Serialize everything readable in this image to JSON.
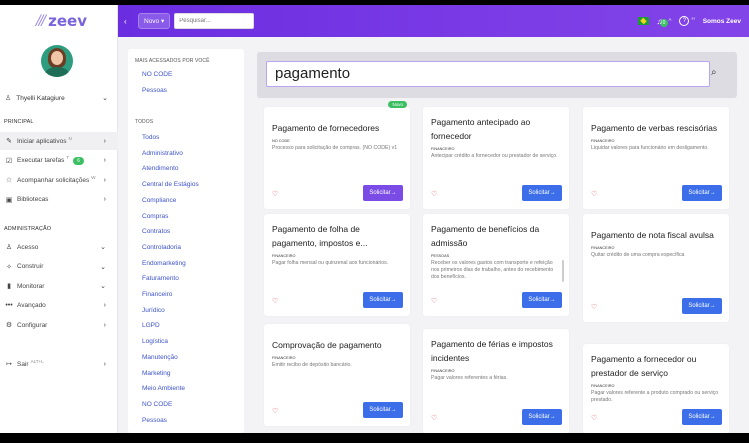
{
  "logo": {
    "text": "zeev"
  },
  "sidebar": {
    "user_name": "Thyelli Katagiure",
    "principal_label": "PRINCIPAL",
    "admin_label": "ADMINISTRAÇÃO",
    "principal_items": [
      {
        "label": "Iniciar aplicativos",
        "sup": "N",
        "icon": "rocket-icon",
        "glyph": "✎"
      },
      {
        "label": "Executar tarefas",
        "sup": "T",
        "badge": "6",
        "icon": "check-square-icon",
        "glyph": "☑"
      },
      {
        "label": "Acompanhar solicitações",
        "sup": "W",
        "icon": "star-icon",
        "glyph": "☆"
      },
      {
        "label": "Bibliotecas",
        "icon": "library-icon",
        "glyph": "▣"
      }
    ],
    "admin_items": [
      {
        "label": "Acesso",
        "icon": "user-icon",
        "glyph": "♙"
      },
      {
        "label": "Construir",
        "icon": "build-icon",
        "glyph": "✧"
      },
      {
        "label": "Monitorar",
        "icon": "bar-chart-icon",
        "glyph": "▮"
      },
      {
        "label": "Avançado",
        "icon": "dots-icon",
        "glyph": "•••"
      },
      {
        "label": "Configurar",
        "icon": "gear-icon",
        "glyph": "⚙"
      }
    ],
    "logout": {
      "label": "Sair",
      "sup": "ALT+L"
    }
  },
  "topbar": {
    "novo_label": "Novo",
    "search_placeholder": "Pesquisar...",
    "notif_count": "0",
    "notif_sup": "A",
    "help_sup": "H",
    "user": "Somos Zeev"
  },
  "filters": {
    "most_accessed_label": "MAIS ACESSADOS POR VOCÊ",
    "most_accessed": [
      "NO CODE",
      "Pessoas"
    ],
    "all_label": "TODOS",
    "all": [
      "Todos",
      "Administrativo",
      "Atendimento",
      "Central de Estágios",
      "Compliance",
      "Compras",
      "Contratos",
      "Controladoria",
      "Endomarketing",
      "Faturamento",
      "Financeiro",
      "Jurídico",
      "LGPD",
      "Logística",
      "Manutenção",
      "Marketing",
      "Meio Ambiente",
      "NO CODE",
      "Pessoas"
    ]
  },
  "search": {
    "value": "pagamento"
  },
  "cards": [
    {
      "title": "Pagamento de fornecedores",
      "category": "NO CODE",
      "desc": "Processo para solicitação de compras. (NO CODE) v1",
      "button": "Solicitar→",
      "badge": "Novo"
    },
    {
      "title": "Pagamento antecipado ao fornecedor",
      "category": "FINANCEIRO",
      "desc": "Antecipar crédito a fornecedor ou prestador de serviço.",
      "button": "Solicitar→"
    },
    {
      "title": "Pagamento de verbas rescisórias",
      "category": "FINANCEIRO",
      "desc": "Liquidar valores para funcionário em desligamento.",
      "button": "Solicitar→"
    },
    {
      "title": "Pagamento de folha de pagamento, impostos e...",
      "category": "FINANCEIRO",
      "desc": "Pagar folha mensal ou quinzenal aos funcionários.",
      "button": "Solicitar→"
    },
    {
      "title": "Pagamento de benefícios da admissão",
      "category": "PESSOAS",
      "desc": "Receber os valores gastos com transporte e refeição nos primeiros dias de trabalho, antes do recebimento dos benefícios.",
      "button": "Solicitar→"
    },
    {
      "title": "Pagamento de nota fiscal avulsa",
      "category": "FINANCEIRO",
      "desc": "Quitar crédito de uma compra específica",
      "button": "Solicitar→"
    },
    {
      "title": "Comprovação de pagamento",
      "category": "FINANCEIRO",
      "desc": "Emitir recibo de depósito bancário.",
      "button": "Solicitar→"
    },
    {
      "title": "Pagamento de férias e impostos incidentes",
      "category": "FINANCEIRO",
      "desc": "Pagar valores referentes a férias.",
      "button": "Solicitar→"
    },
    {
      "title": "Pagamento a fornecedor ou prestador de serviço",
      "category": "FINANCEIRO",
      "desc": "Pagar valores referente a produto comprado ou serviço prestado.",
      "button": "Solicitar→"
    }
  ]
}
